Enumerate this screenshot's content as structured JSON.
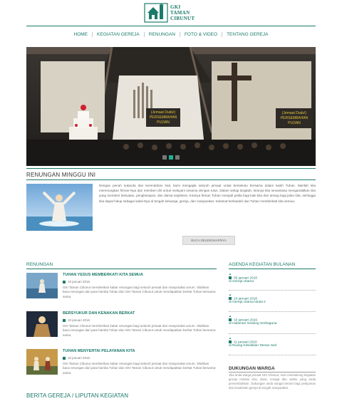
{
  "brand": {
    "line1": "GKI",
    "line2": "TAMAN",
    "line3": "CIBUNUT"
  },
  "nav": [
    "HOME",
    "KEGIATAN GEREJA",
    "RENUNGAN",
    "FOTO & VIDEO",
    "TENTANG GEREJA"
  ],
  "hero": {
    "banner_left": {
      "line1": "(Jemaat Dudu!)",
      "line2": "PERSEMBAHAN",
      "line3": "PUJIAN"
    },
    "banner_right": {
      "line1": "(Jemaat Dudu!)",
      "line2": "PERSEMBAHAN",
      "line3": "PUJIAN"
    },
    "slides_total": 3,
    "slide_active": 1
  },
  "renungan_minggu": {
    "title": "RENUNGAN MINGGU INI",
    "text": "Dengan penuh sukacita dan kerendahan hati, kami mengajak seluruh jemaat untuk bersekutu bersama dalam kasih Tuhan. Marilah kita merenungkan firman-Nya dan memberi diri untuk melayani sesama dengan tulus. Dalam setiap langkah, kiranya kita senantiasa mengandalkan Dia yang memberi kekuatan, pengharapan, dan damai sejahtera. Kiranya firman Tuhan menjadi pelita bagi kaki kita dan terang bagi jalan kita, sehingga kita dapat hidup sebagai saksi-Nya di tengah keluarga, gereja, dan masyarakat. Selamat beribadah dan Tuhan memberkati kita semua.",
    "button": "BACA SELENGKAPNYA"
  },
  "renungan": {
    "title": "RENUNGAN",
    "items": [
      {
        "title": "TUHAN YESUS MEMBERKATI KITA SEMUA",
        "date": "10 januari 2016",
        "text": "GKI Taman Cibunut memberikan kabar renungan bagi seluruh jemaat dan masyarakat umum. Silahkan baca renungan dari para hamba Tuhan dan GKI Taman Cibunut untuk mendapatkan berkat Tuhan bersama-sama."
      },
      {
        "title": "BERSYUKUR DAN KENAKAN BERKAT",
        "date": "10 januari 2016",
        "text": "GKI Taman Cibunut memberikan kabar renungan bagi seluruh jemaat dan masyarakat umum. Silahkan baca renungan dari para hamba Tuhan dan GKI Taman Cibunut untuk mendapatkan berkat Tuhan bersama-sama."
      },
      {
        "title": "TUHAN MENYERTAI PELAYANAN KITA",
        "date": "10 januari 2016",
        "text": "GKI Taman Cibunut memberikan kabar renungan bagi seluruh jemaat dan masyarakat umum. Silahkan baca renungan dari para hamba Tuhan dan GKI Taman Cibunut untuk mendapatkan berkat Tuhan bersama-sama."
      }
    ]
  },
  "agenda": {
    "title": "AGENDA KEGIATAN BULANAN",
    "items": [
      {
        "date": "05 januari 2016",
        "place": "di Gereja Utama"
      },
      {
        "date": "10 januari 2016",
        "place": "di Gereja Utama lantai 2"
      },
      {
        "date": "10 januari 2016",
        "place": "di Halaman Gedung Serbaguna"
      },
      {
        "date": "11 januari 2016",
        "place": "di Ruang Kebaktian Taman Sari"
      }
    ]
  },
  "dukungan": {
    "title": "DUKUNGAN WARGA",
    "text": "Jika anda warga jemaat GKI Cibunut, mari mendukung kegiatan gereja melalui doa, dana, tenaga dan waktu yang anda persembahkan. Dukungan anda sangat berarti bagi pelayanan dan kesaksian gereja di tengah masyarakat."
  },
  "berita": {
    "title": "BERITA GEREJA / LIPUTAN KEGIATAN"
  },
  "colors": {
    "accent": "#1b7a6a",
    "slider_active": "#1fb096"
  }
}
